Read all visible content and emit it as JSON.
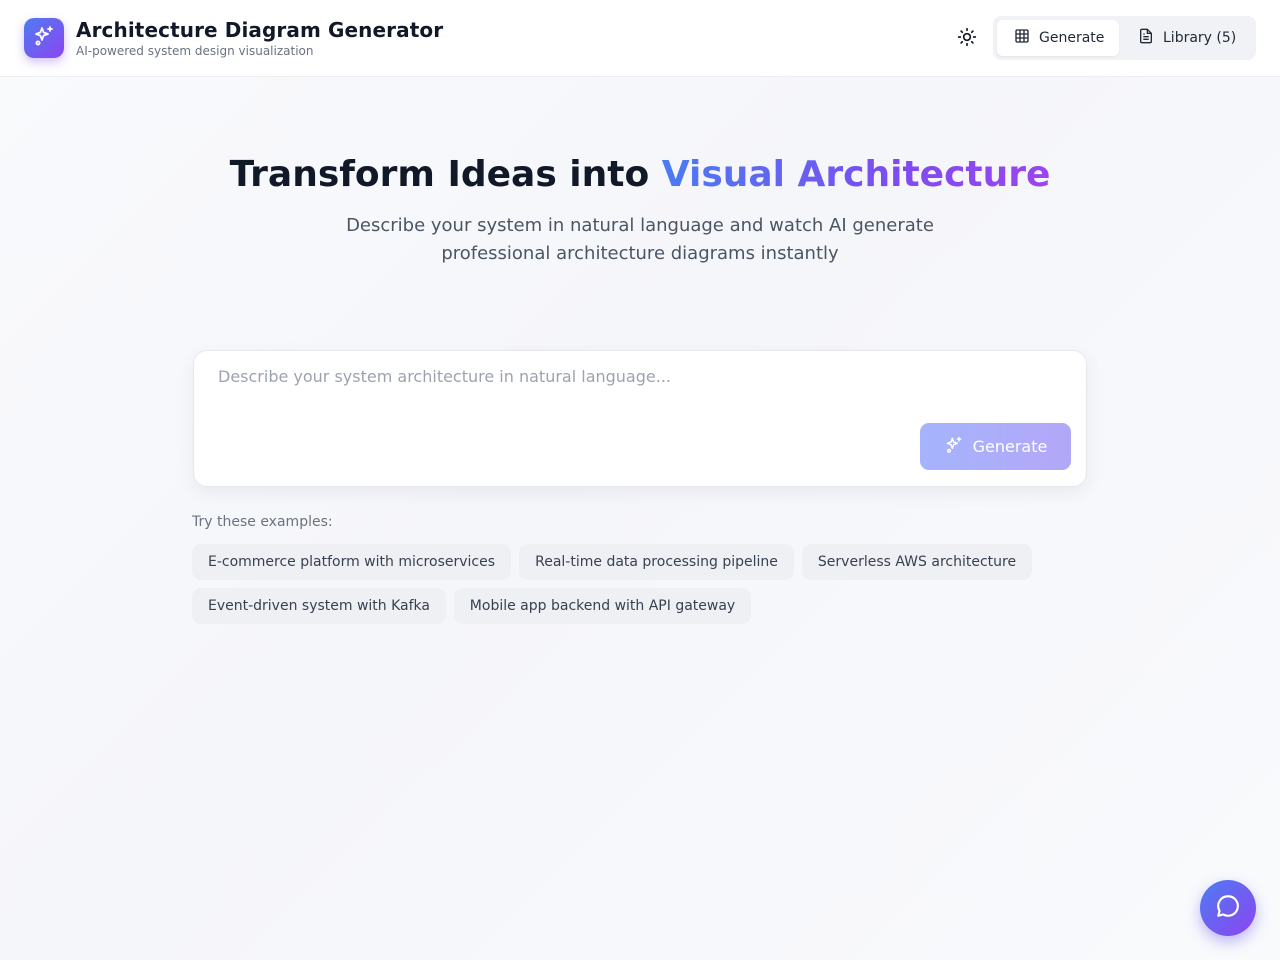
{
  "header": {
    "title": "Architecture Diagram Generator",
    "subtitle": "AI-powered system design visualization",
    "logo_icon": "sparkles-icon",
    "theme_icon": "sun-icon",
    "nav": [
      {
        "label": "Generate",
        "icon": "grid-icon",
        "active": true
      },
      {
        "label": "Library (5)",
        "icon": "document-icon",
        "active": false
      }
    ]
  },
  "hero": {
    "title_plain": "Transform Ideas into ",
    "title_highlight": "Visual Architecture",
    "description": "Describe your system in natural language and watch AI generate professional architecture diagrams instantly"
  },
  "prompt": {
    "placeholder": "Describe your system architecture in natural language...",
    "value": "",
    "generate_label": "Generate",
    "generate_icon": "sparkles-icon"
  },
  "examples": {
    "label": "Try these examples:",
    "items": [
      "E-commerce platform with microservices",
      "Real-time data processing pipeline",
      "Serverless AWS architecture",
      "Event-driven system with Kafka",
      "Mobile app backend with API gateway"
    ]
  },
  "chat": {
    "icon": "chat-bubble-icon"
  },
  "colors": {
    "accent_start": "#4f7bf2",
    "accent_end": "#8b45f0",
    "generate_disabled": "#a5b4fc",
    "background": "#f8f9fc"
  }
}
